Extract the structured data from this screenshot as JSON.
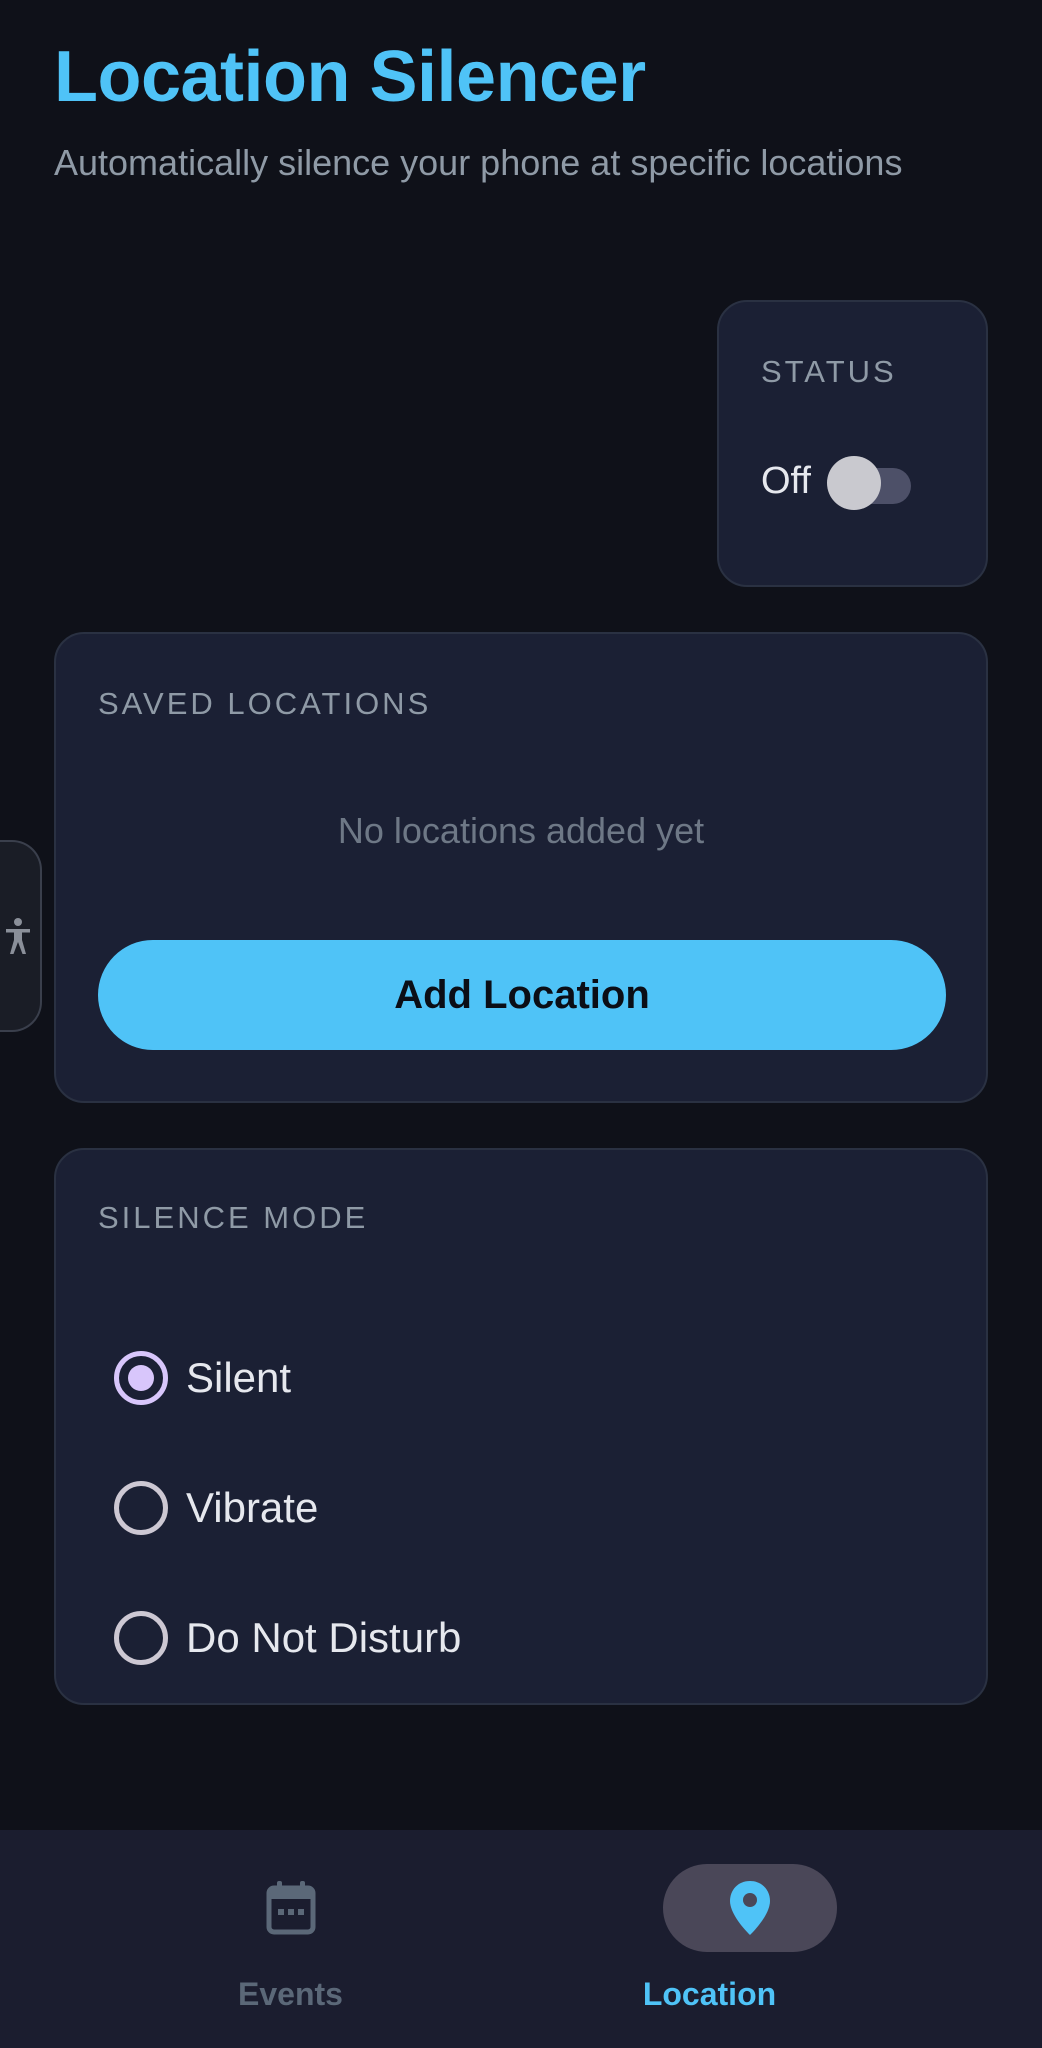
{
  "header": {
    "title": "Location Silencer",
    "subtitle": "Automatically silence your phone at specific locations"
  },
  "status": {
    "label": "STATUS",
    "value_text": "Off",
    "enabled": false
  },
  "saved_locations": {
    "label": "SAVED LOCATIONS",
    "empty_text": "No locations added yet",
    "add_button_label": "Add Location"
  },
  "silence_mode": {
    "label": "SILENCE MODE",
    "options": [
      {
        "label": "Silent",
        "selected": true
      },
      {
        "label": "Vibrate",
        "selected": false
      },
      {
        "label": "Do Not Disturb",
        "selected": false
      }
    ]
  },
  "bottom_nav": {
    "items": [
      {
        "label": "Events",
        "icon": "calendar-icon",
        "active": false
      },
      {
        "label": "Location",
        "icon": "map-pin-icon",
        "active": true
      }
    ]
  },
  "colors": {
    "accent": "#4fc3f7",
    "background": "#0f1119",
    "card": "#1b2034",
    "radio_selected": "#d8c6fb"
  }
}
